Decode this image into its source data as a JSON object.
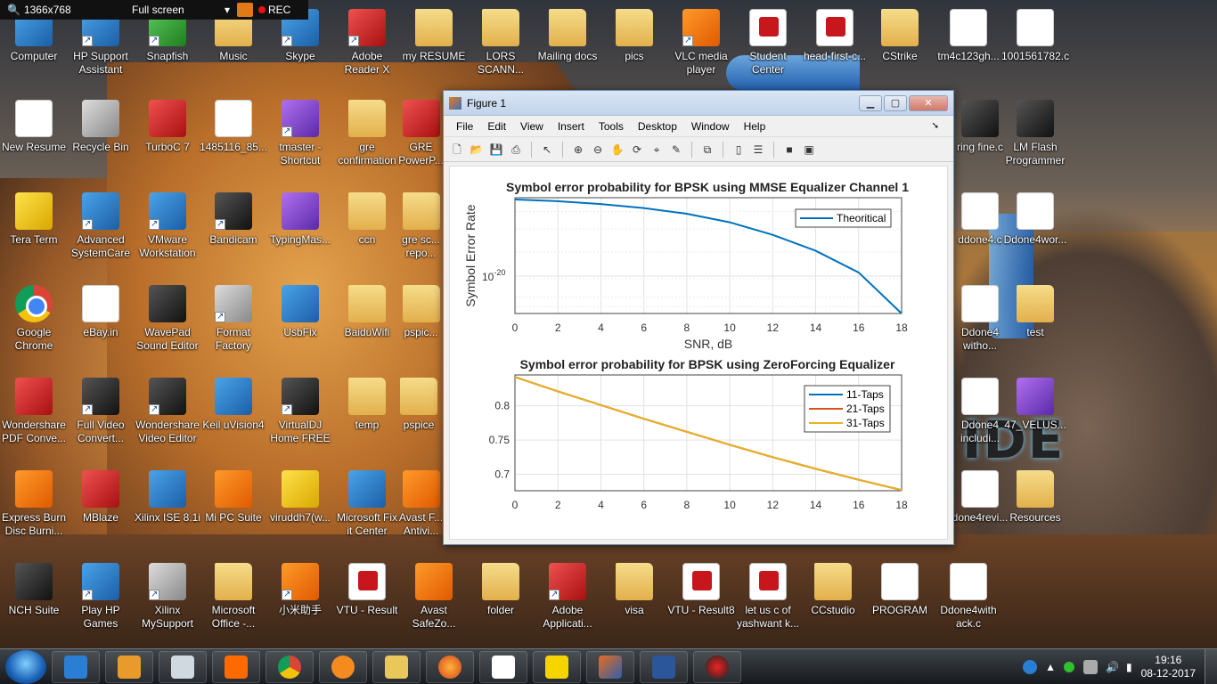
{
  "recorder": {
    "resolution": "1366x768",
    "mode": "Full screen",
    "rec_label": "REC"
  },
  "desktop_icons": [
    {
      "label": "Computer"
    },
    {
      "label": "HP Support Assistant"
    },
    {
      "label": "Snapfish"
    },
    {
      "label": "Music"
    },
    {
      "label": "Skype"
    },
    {
      "label": "Adobe Reader X"
    },
    {
      "label": "my RESUME"
    },
    {
      "label": "LORS SCANN..."
    },
    {
      "label": "Mailing docs"
    },
    {
      "label": "pics"
    },
    {
      "label": "VLC media player"
    },
    {
      "label": "Student Center"
    },
    {
      "label": "head-first-c..."
    },
    {
      "label": "CStrike"
    },
    {
      "label": "tm4c123gh..."
    },
    {
      "label": "1001561782.c"
    },
    {
      "label": "New Resume"
    },
    {
      "label": "Recycle Bin"
    },
    {
      "label": "TurboC 7"
    },
    {
      "label": "1485116_85..."
    },
    {
      "label": "tmaster - Shortcut"
    },
    {
      "label": "gre confirmation"
    },
    {
      "label": "GRE PowerP..."
    },
    {
      "label": "ring fine.c"
    },
    {
      "label": "LM Flash Programmer"
    },
    {
      "label": "Tera Term"
    },
    {
      "label": "Advanced SystemCare"
    },
    {
      "label": "VMware Workstation"
    },
    {
      "label": "Bandicam"
    },
    {
      "label": "TypingMas..."
    },
    {
      "label": "ccn"
    },
    {
      "label": "gre sc... repo..."
    },
    {
      "label": "ddone4.c"
    },
    {
      "label": "Ddone4wor..."
    },
    {
      "label": "Google Chrome"
    },
    {
      "label": "eBay.in"
    },
    {
      "label": "WavePad Sound Editor"
    },
    {
      "label": "Format Factory"
    },
    {
      "label": "UsbFix"
    },
    {
      "label": "BaiduWifi"
    },
    {
      "label": "pspic..."
    },
    {
      "label": "Ddone4 witho..."
    },
    {
      "label": "test"
    },
    {
      "label": "Wondershare PDF Conve..."
    },
    {
      "label": "Full Video Convert..."
    },
    {
      "label": "Wondershare Video Editor"
    },
    {
      "label": "Keil uVision4"
    },
    {
      "label": "VirtualDJ Home FREE"
    },
    {
      "label": "temp"
    },
    {
      "label": "pspice"
    },
    {
      "label": "Ddone4 includi..."
    },
    {
      "label": "47_VELUS..."
    },
    {
      "label": "Express Burn Disc Burni..."
    },
    {
      "label": "MBlaze"
    },
    {
      "label": "Xilinx ISE 8.1i"
    },
    {
      "label": "Mi PC Suite"
    },
    {
      "label": "viruddh7(w..."
    },
    {
      "label": "Microsoft Fix it Center"
    },
    {
      "label": "Avast F... Antivi..."
    },
    {
      "label": "done4revi..."
    },
    {
      "label": "Resources"
    },
    {
      "label": "NCH Suite"
    },
    {
      "label": "Play HP Games"
    },
    {
      "label": "Xilinx MySupport"
    },
    {
      "label": "Microsoft Office -..."
    },
    {
      "label": "小米助手"
    },
    {
      "label": "VTU - Result"
    },
    {
      "label": "Avast SafeZo..."
    },
    {
      "label": "folder"
    },
    {
      "label": "Adobe Applicati..."
    },
    {
      "label": "visa"
    },
    {
      "label": "VTU - Result8"
    },
    {
      "label": "let us c of yashwant k..."
    },
    {
      "label": "CCstudio"
    },
    {
      "label": "PROGRAM"
    },
    {
      "label": "Ddone4with ack.c"
    }
  ],
  "wallpaper_text": "IDE",
  "figure": {
    "title": "Figure 1",
    "menu": [
      "File",
      "Edit",
      "View",
      "Insert",
      "Tools",
      "Desktop",
      "Window",
      "Help"
    ],
    "toolbar_icons": [
      "new-figure-icon",
      "open-icon",
      "save-icon",
      "print-icon",
      "pointer-icon",
      "zoom-in-icon",
      "zoom-out-icon",
      "pan-icon",
      "rotate-icon",
      "data-cursor-icon",
      "brush-icon",
      "link-icon",
      "colorbar-icon",
      "legend-icon",
      "hide-tools-icon",
      "show-tools-icon"
    ]
  },
  "chart_data": [
    {
      "type": "line",
      "title": "Symbol error probability for BPSK using MMSE Equalizer Channel 1",
      "xlabel": "SNR, dB",
      "ylabel": "Symbol Error Rate",
      "yscale": "log",
      "xlim": [
        0,
        18
      ],
      "xticks": [
        0,
        2,
        4,
        6,
        8,
        10,
        12,
        14,
        16,
        18
      ],
      "ytick_label": {
        "base": "10",
        "exp": "-20"
      },
      "legend": "top-right",
      "grid": true,
      "series": [
        {
          "name": "Theoritical",
          "color": "#0072bd",
          "x": [
            0,
            2,
            4,
            6,
            8,
            10,
            12,
            14,
            16,
            18
          ],
          "y_frac": [
            1.0,
            0.985,
            0.96,
            0.925,
            0.875,
            0.8,
            0.69,
            0.55,
            0.36,
            0.0
          ]
        }
      ]
    },
    {
      "type": "line",
      "title": "Symbol error probability for BPSK using ZeroForcing Equalizer",
      "xlim": [
        0,
        18
      ],
      "ylim": [
        0.676,
        0.845
      ],
      "xticks": [
        0,
        2,
        4,
        6,
        8,
        10,
        12,
        14,
        16,
        18
      ],
      "yticks": [
        0.7,
        0.75,
        0.8
      ],
      "legend": "top-right",
      "grid": true,
      "series": [
        {
          "name": "11-Taps",
          "color": "#0072bd",
          "x": [
            0,
            2,
            4,
            6,
            8,
            10,
            12,
            14,
            16,
            18
          ],
          "y": [
            0.842,
            0.821,
            0.801,
            0.781,
            0.762,
            0.743,
            0.725,
            0.708,
            0.692,
            0.677
          ]
        },
        {
          "name": "21-Taps",
          "color": "#d95319",
          "x": [
            0,
            2,
            4,
            6,
            8,
            10,
            12,
            14,
            16,
            18
          ],
          "y": [
            0.842,
            0.821,
            0.801,
            0.781,
            0.762,
            0.743,
            0.725,
            0.708,
            0.692,
            0.677
          ]
        },
        {
          "name": "31-Taps",
          "color": "#edb120",
          "x": [
            0,
            2,
            4,
            6,
            8,
            10,
            12,
            14,
            16,
            18
          ],
          "y": [
            0.842,
            0.821,
            0.801,
            0.781,
            0.762,
            0.743,
            0.725,
            0.708,
            0.692,
            0.677
          ]
        }
      ]
    }
  ],
  "taskbar": {
    "apps": [
      "hp-icon",
      "media-player-icon",
      "snipping-icon",
      "mi-icon",
      "chrome-icon",
      "avast-icon",
      "explorer-icon",
      "firefox-icon",
      "notepad-icon",
      "teraterm-icon",
      "matlab-icon",
      "word-icon",
      "bandicam-icon"
    ],
    "time": "19:16",
    "date": "08-12-2017"
  }
}
